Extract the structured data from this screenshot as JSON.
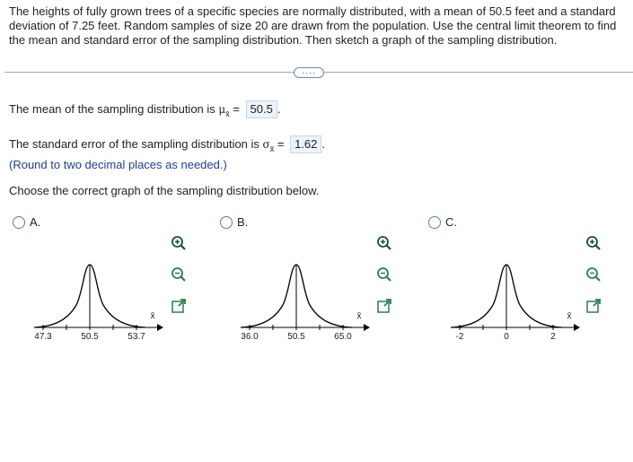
{
  "problem_text": "The heights of fully grown trees of a specific species are normally distributed, with a mean of 50.5 feet and a standard deviation of 7.25 feet. Random samples of size 20 are drawn from the population. Use the central limit theorem to find the mean and standard error of the sampling distribution. Then sketch a graph of the sampling distribution.",
  "more_button_label": "····",
  "mean": {
    "prefix": "The mean of the sampling distribution is ",
    "symbol": "μ",
    "symbol_sub": "x̄",
    "equals": " = ",
    "value": "50.5",
    "suffix": "."
  },
  "se": {
    "prefix": "The standard error of the sampling distribution is ",
    "symbol": "σ",
    "symbol_sub": "x̄",
    "equals": " = ",
    "value": "1.62",
    "suffix": "."
  },
  "round_hint": "(Round to two decimal places as needed.)",
  "choose_prompt": "Choose the correct graph of the sampling distribution below.",
  "options": [
    {
      "label": "A.",
      "ticks": [
        "47.3",
        "50.5",
        "53.7"
      ],
      "axis_var": "x̄"
    },
    {
      "label": "B.",
      "ticks": [
        "36.0",
        "50.5",
        "65.0"
      ],
      "axis_var": "x̄"
    },
    {
      "label": "C.",
      "ticks": [
        "-2",
        "0",
        "2"
      ],
      "axis_var": "x̄"
    }
  ],
  "icons": {
    "zoom_in": "zoom-in-icon",
    "zoom_out": "zoom-out-icon",
    "expand": "expand-icon"
  },
  "colors": {
    "hint": "#1f3f8f",
    "answer_bg": "#edf3fb",
    "radio": "#5a7cc0"
  }
}
